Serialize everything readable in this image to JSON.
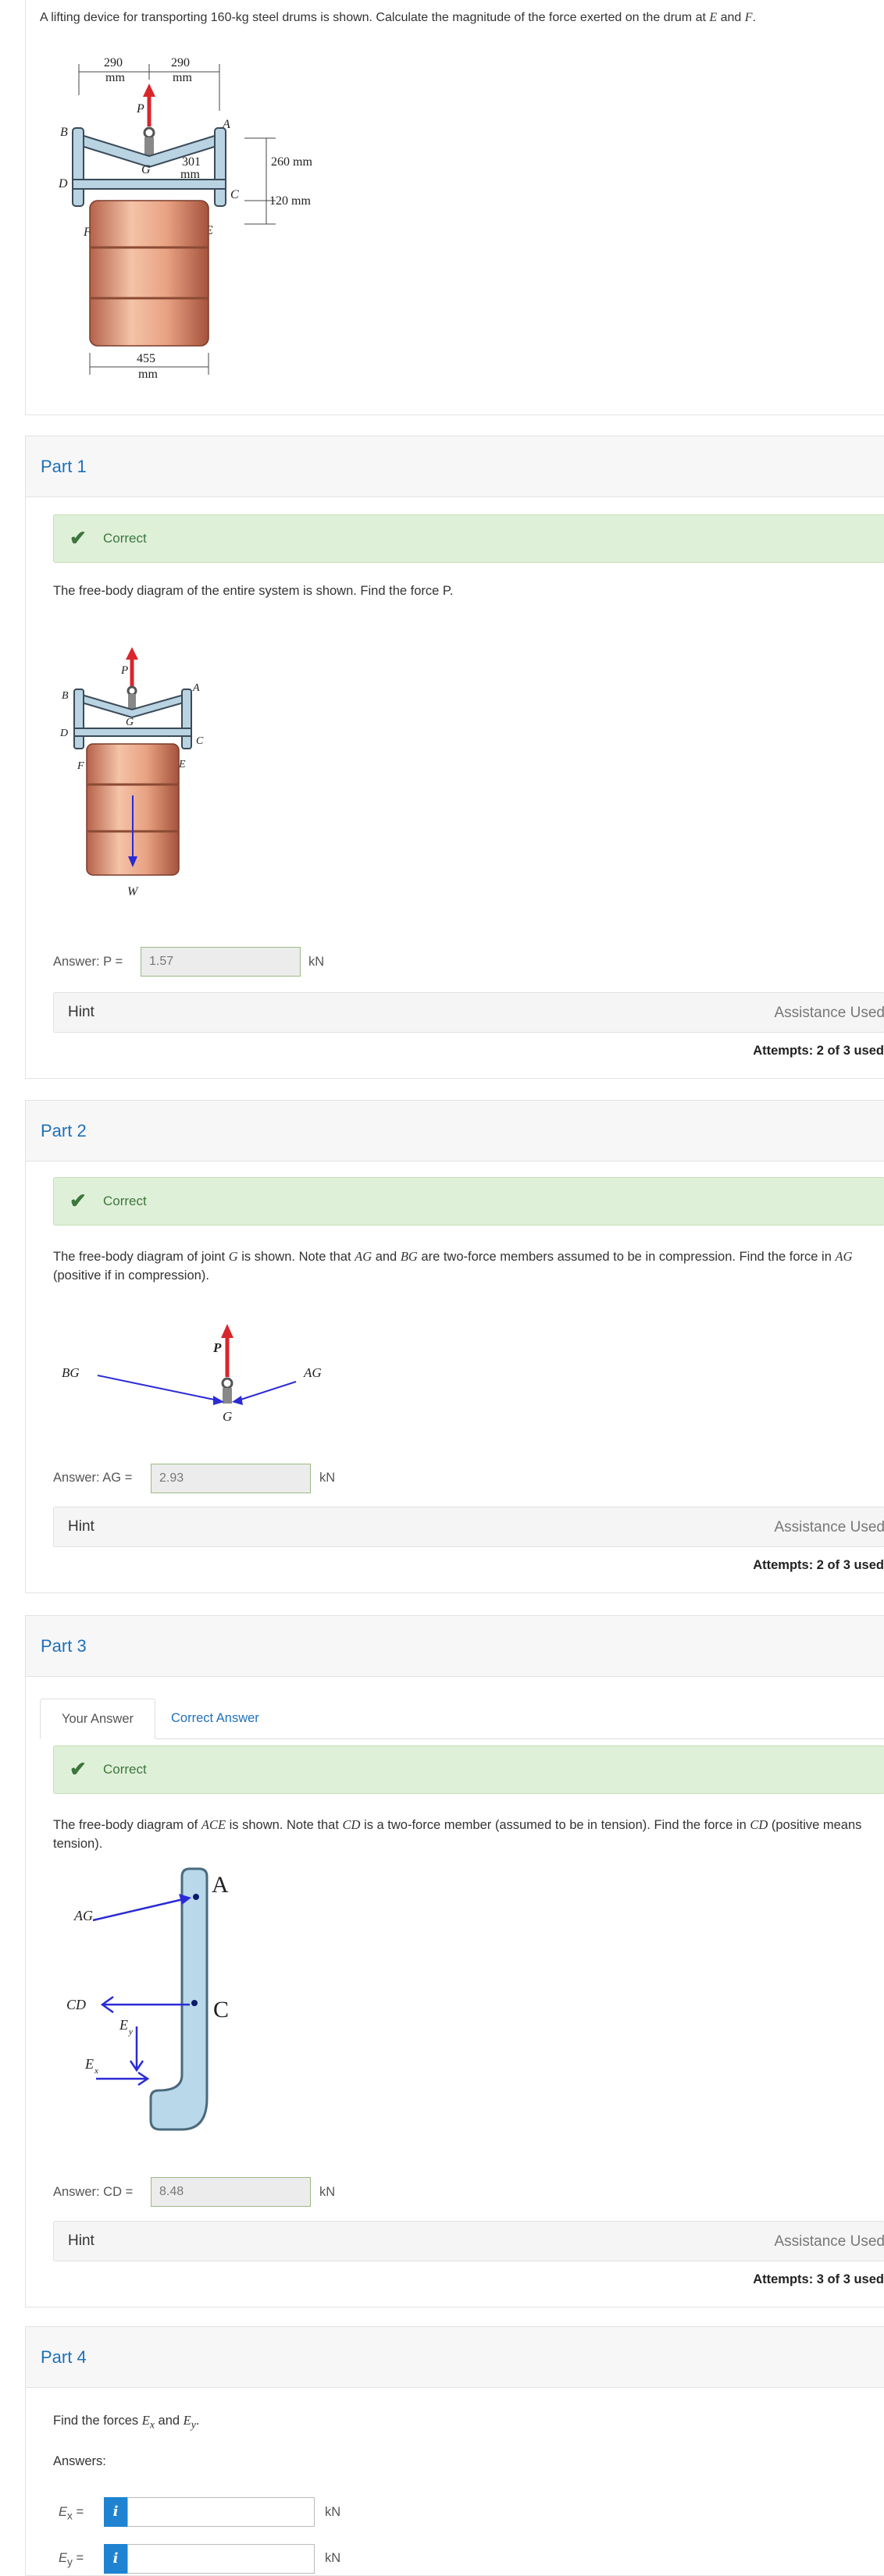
{
  "problem": {
    "text_pre": "A lifting device for transporting 160-kg steel drums is shown. Calculate the magnitude of the force exerted on the drum at ",
    "e": "E",
    "and": " and ",
    "f": "F",
    "end": ".",
    "figure": {
      "dim_290_left": "290",
      "dim_290_right": "290",
      "mm": "mm",
      "dim_301": "301",
      "dim_260": "260 mm",
      "dim_120": "120 mm",
      "dim_455": "455",
      "labels": {
        "p": "P",
        "a": "A",
        "b": "B",
        "c": "C",
        "d": "D",
        "e": "E",
        "f": "F",
        "g": "G"
      }
    }
  },
  "part1": {
    "title": "Part 1",
    "status": "Correct",
    "question": "The free-body diagram of the entire system is shown. Find the force P.",
    "answer_label": "Answer: P =",
    "answer_value": "1.57",
    "unit": "kN",
    "hint": "Hint",
    "assistance": "Assistance Used",
    "attempts": "Attempts: 2 of 3 used",
    "figure": {
      "w": "W"
    }
  },
  "part2": {
    "title": "Part 2",
    "status": "Correct",
    "question_a": "The free-body diagram of joint ",
    "question_g": "G",
    "question_b": " is shown. Note that ",
    "question_ag": "AG",
    "question_c": " and ",
    "question_bg": "BG",
    "question_d": " are two-force members assumed to be in compression. Find the force in ",
    "question_ag2": "AG",
    "question_e": " (positive if in compression).",
    "answer_label": "Answer: AG =",
    "answer_value": "2.93",
    "unit": "kN",
    "hint": "Hint",
    "assistance": "Assistance Used",
    "attempts": "Attempts: 2 of 3 used",
    "figure": {
      "bg": "BG",
      "ag": "AG",
      "p": "P",
      "g": "G"
    }
  },
  "part3": {
    "title": "Part 3",
    "tab_your_answer": "Your Answer",
    "tab_correct_answer": "Correct Answer",
    "status": "Correct",
    "question_a": "The free-body diagram of ",
    "question_ace": "ACE",
    "question_b": " is shown. Note that ",
    "question_cd": "CD",
    "question_c": " is a two-force member (assumed to be in tension). Find the force in ",
    "question_cd2": "CD",
    "question_d": " (positive means tension).",
    "answer_label": "Answer: CD =",
    "answer_value": "8.48",
    "unit": "kN",
    "hint": "Hint",
    "assistance": "Assistance Used",
    "attempts": "Attempts: 3 of 3 used",
    "figure": {
      "ag": "AG",
      "cd": "CD",
      "a": "A",
      "c": "C",
      "e": "E",
      "ey": "E",
      "ex": "E",
      "y": "y",
      "x": "x"
    }
  },
  "part4": {
    "title": "Part 4",
    "question_a": "Find the forces ",
    "question_ex": "E",
    "question_x": "x",
    "question_b": " and ",
    "question_ey": "E",
    "question_y": "y",
    "question_c": ".",
    "answers_label": "Answers:",
    "ex_label": "E",
    "ex_sub": "x",
    "ey_label": "E",
    "ey_sub": "y",
    "equals": "=",
    "info": "i",
    "unit": "kN"
  }
}
